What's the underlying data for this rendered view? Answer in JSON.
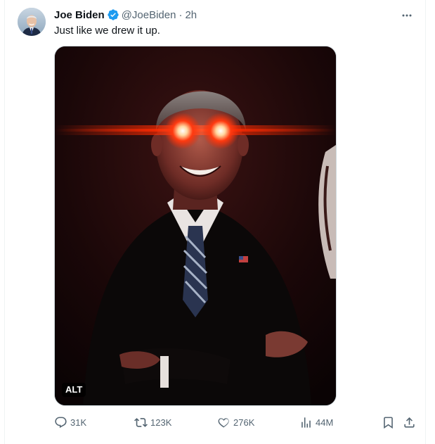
{
  "tweet": {
    "author_name": "Joe Biden",
    "handle": "@JoeBiden",
    "separator": "·",
    "time": "2h",
    "text": "Just like we drew it up.",
    "media_alt_badge": "ALT"
  },
  "actions": {
    "replies": "31K",
    "reposts": "123K",
    "likes": "276K",
    "views": "44M"
  },
  "colors": {
    "verified": "#1d9bf0",
    "secondary_text": "#536471",
    "laser": "#ff2a00"
  },
  "icons": {
    "verified": "verified-badge-icon",
    "more": "more-icon",
    "reply": "reply-icon",
    "repost": "repost-icon",
    "like": "heart-icon",
    "views": "views-icon",
    "bookmark": "bookmark-icon",
    "share": "share-icon"
  }
}
